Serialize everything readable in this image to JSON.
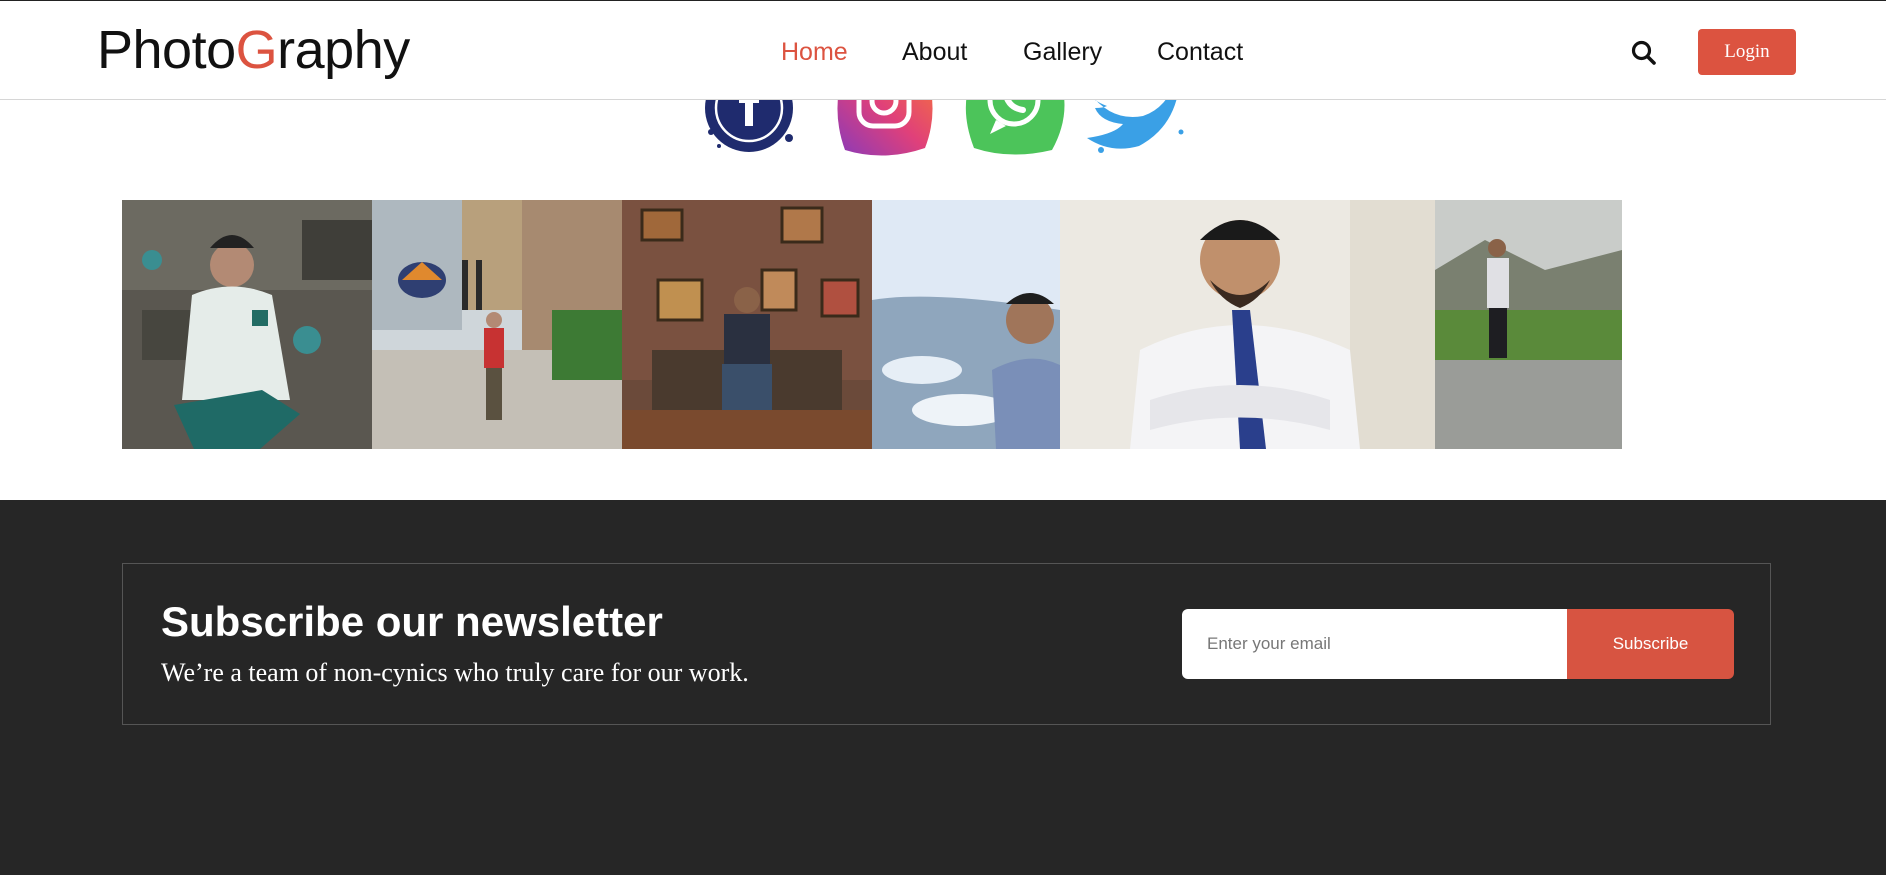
{
  "header": {
    "logo_part1": "Photo",
    "logo_accent": "G",
    "logo_part2": "raphy",
    "nav": [
      {
        "label": "Home",
        "active": true
      },
      {
        "label": "About",
        "active": false
      },
      {
        "label": "Gallery",
        "active": false
      },
      {
        "label": "Contact",
        "active": false
      }
    ],
    "search_icon": "search-icon",
    "login_label": "Login"
  },
  "social": [
    {
      "name": "facebook-icon",
      "color": "#1f2b6e"
    },
    {
      "name": "instagram-icon",
      "color": "#c9408a"
    },
    {
      "name": "whatsapp-icon",
      "color": "#4cc45a"
    },
    {
      "name": "twitter-icon",
      "color": "#3aa0e6"
    }
  ],
  "gallery": {
    "photos": [
      "photo-man-hoodie-stone-wall",
      "photo-man-red-jacket-building",
      "photo-man-sitting-brick-wall",
      "photo-selfie-river",
      "photo-man-white-shirt-tie",
      "photo-man-mountain-road"
    ]
  },
  "newsletter": {
    "title": "Subscribe our newsletter",
    "subtitle": "We’re a team of non-cynics who truly care for our work.",
    "email_placeholder": "Enter your email",
    "subscribe_label": "Subscribe"
  },
  "colors": {
    "accent": "#dc5340",
    "footer_bg": "#262626"
  }
}
